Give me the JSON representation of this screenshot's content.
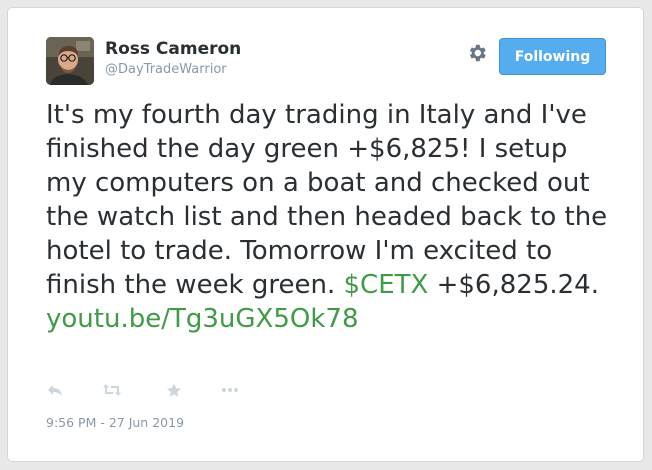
{
  "user": {
    "name": "Ross Cameron",
    "handle": "@DayTradeWarrior",
    "avatar_icon": "user-photo"
  },
  "header": {
    "follow_label": "Following",
    "settings_icon": "gear-icon"
  },
  "tweet": {
    "text_part1": "It's my fourth day trading in Italy and I've finished the day green +$6,825! I setup my computers on a boat and checked out the watch list and then headed back to the hotel to trade. Tomorrow I'm excited to finish the week green. ",
    "cashtag": "$CETX",
    "text_part2": " +$6,825.24. ",
    "link": "youtu.be/Tg3uGX5Ok78"
  },
  "actions": {
    "reply_icon": "reply-icon",
    "retweet_icon": "retweet-icon",
    "like_icon": "star-icon",
    "more_icon": "more-icon"
  },
  "timestamp": "9:56 PM - 27 Jun 2019",
  "colors": {
    "accent_link": "#3f9b45",
    "button_blue": "#55acee",
    "muted": "#8899a6",
    "text": "#292f33"
  }
}
